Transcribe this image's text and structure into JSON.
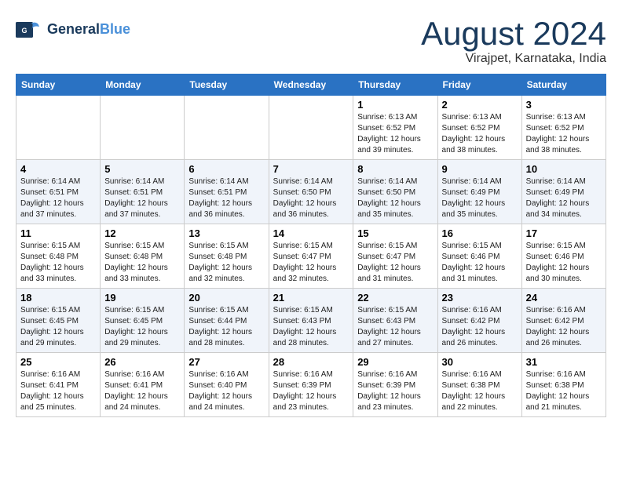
{
  "header": {
    "logo_line1": "General",
    "logo_line2": "Blue",
    "month": "August 2024",
    "location": "Virajpet, Karnataka, India"
  },
  "weekdays": [
    "Sunday",
    "Monday",
    "Tuesday",
    "Wednesday",
    "Thursday",
    "Friday",
    "Saturday"
  ],
  "weeks": [
    [
      {
        "day": "",
        "info": ""
      },
      {
        "day": "",
        "info": ""
      },
      {
        "day": "",
        "info": ""
      },
      {
        "day": "",
        "info": ""
      },
      {
        "day": "1",
        "info": "Sunrise: 6:13 AM\nSunset: 6:52 PM\nDaylight: 12 hours\nand 39 minutes."
      },
      {
        "day": "2",
        "info": "Sunrise: 6:13 AM\nSunset: 6:52 PM\nDaylight: 12 hours\nand 38 minutes."
      },
      {
        "day": "3",
        "info": "Sunrise: 6:13 AM\nSunset: 6:52 PM\nDaylight: 12 hours\nand 38 minutes."
      }
    ],
    [
      {
        "day": "4",
        "info": "Sunrise: 6:14 AM\nSunset: 6:51 PM\nDaylight: 12 hours\nand 37 minutes."
      },
      {
        "day": "5",
        "info": "Sunrise: 6:14 AM\nSunset: 6:51 PM\nDaylight: 12 hours\nand 37 minutes."
      },
      {
        "day": "6",
        "info": "Sunrise: 6:14 AM\nSunset: 6:51 PM\nDaylight: 12 hours\nand 36 minutes."
      },
      {
        "day": "7",
        "info": "Sunrise: 6:14 AM\nSunset: 6:50 PM\nDaylight: 12 hours\nand 36 minutes."
      },
      {
        "day": "8",
        "info": "Sunrise: 6:14 AM\nSunset: 6:50 PM\nDaylight: 12 hours\nand 35 minutes."
      },
      {
        "day": "9",
        "info": "Sunrise: 6:14 AM\nSunset: 6:49 PM\nDaylight: 12 hours\nand 35 minutes."
      },
      {
        "day": "10",
        "info": "Sunrise: 6:14 AM\nSunset: 6:49 PM\nDaylight: 12 hours\nand 34 minutes."
      }
    ],
    [
      {
        "day": "11",
        "info": "Sunrise: 6:15 AM\nSunset: 6:48 PM\nDaylight: 12 hours\nand 33 minutes."
      },
      {
        "day": "12",
        "info": "Sunrise: 6:15 AM\nSunset: 6:48 PM\nDaylight: 12 hours\nand 33 minutes."
      },
      {
        "day": "13",
        "info": "Sunrise: 6:15 AM\nSunset: 6:48 PM\nDaylight: 12 hours\nand 32 minutes."
      },
      {
        "day": "14",
        "info": "Sunrise: 6:15 AM\nSunset: 6:47 PM\nDaylight: 12 hours\nand 32 minutes."
      },
      {
        "day": "15",
        "info": "Sunrise: 6:15 AM\nSunset: 6:47 PM\nDaylight: 12 hours\nand 31 minutes."
      },
      {
        "day": "16",
        "info": "Sunrise: 6:15 AM\nSunset: 6:46 PM\nDaylight: 12 hours\nand 31 minutes."
      },
      {
        "day": "17",
        "info": "Sunrise: 6:15 AM\nSunset: 6:46 PM\nDaylight: 12 hours\nand 30 minutes."
      }
    ],
    [
      {
        "day": "18",
        "info": "Sunrise: 6:15 AM\nSunset: 6:45 PM\nDaylight: 12 hours\nand 29 minutes."
      },
      {
        "day": "19",
        "info": "Sunrise: 6:15 AM\nSunset: 6:45 PM\nDaylight: 12 hours\nand 29 minutes."
      },
      {
        "day": "20",
        "info": "Sunrise: 6:15 AM\nSunset: 6:44 PM\nDaylight: 12 hours\nand 28 minutes."
      },
      {
        "day": "21",
        "info": "Sunrise: 6:15 AM\nSunset: 6:43 PM\nDaylight: 12 hours\nand 28 minutes."
      },
      {
        "day": "22",
        "info": "Sunrise: 6:15 AM\nSunset: 6:43 PM\nDaylight: 12 hours\nand 27 minutes."
      },
      {
        "day": "23",
        "info": "Sunrise: 6:16 AM\nSunset: 6:42 PM\nDaylight: 12 hours\nand 26 minutes."
      },
      {
        "day": "24",
        "info": "Sunrise: 6:16 AM\nSunset: 6:42 PM\nDaylight: 12 hours\nand 26 minutes."
      }
    ],
    [
      {
        "day": "25",
        "info": "Sunrise: 6:16 AM\nSunset: 6:41 PM\nDaylight: 12 hours\nand 25 minutes."
      },
      {
        "day": "26",
        "info": "Sunrise: 6:16 AM\nSunset: 6:41 PM\nDaylight: 12 hours\nand 24 minutes."
      },
      {
        "day": "27",
        "info": "Sunrise: 6:16 AM\nSunset: 6:40 PM\nDaylight: 12 hours\nand 24 minutes."
      },
      {
        "day": "28",
        "info": "Sunrise: 6:16 AM\nSunset: 6:39 PM\nDaylight: 12 hours\nand 23 minutes."
      },
      {
        "day": "29",
        "info": "Sunrise: 6:16 AM\nSunset: 6:39 PM\nDaylight: 12 hours\nand 23 minutes."
      },
      {
        "day": "30",
        "info": "Sunrise: 6:16 AM\nSunset: 6:38 PM\nDaylight: 12 hours\nand 22 minutes."
      },
      {
        "day": "31",
        "info": "Sunrise: 6:16 AM\nSunset: 6:38 PM\nDaylight: 12 hours\nand 21 minutes."
      }
    ]
  ]
}
